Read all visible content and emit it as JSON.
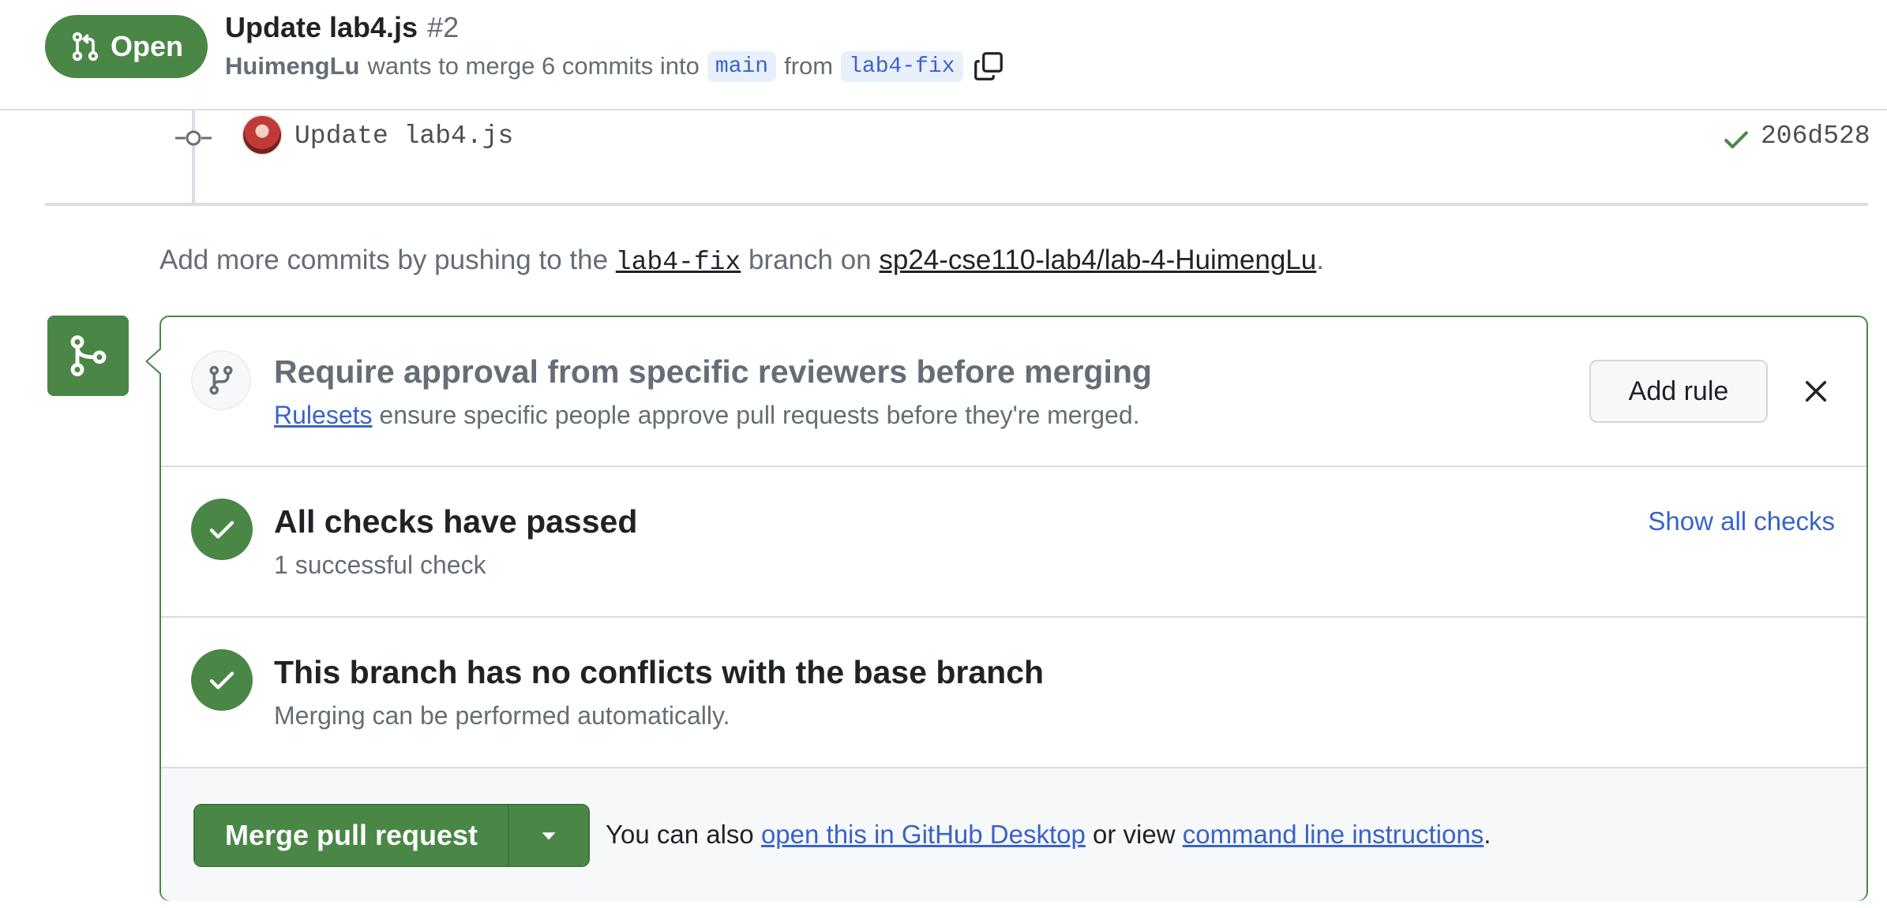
{
  "header": {
    "state_label": "Open",
    "title": "Update lab4.js",
    "number": "#2",
    "author": "HuimengLu",
    "merge_text": "wants to merge 6 commits into",
    "base_branch": "main",
    "from_text": "from",
    "head_branch": "lab4-fix"
  },
  "commit": {
    "message": "Update lab4.js",
    "sha": "206d528",
    "status": "success"
  },
  "push_hint": {
    "prefix": "Add more commits by pushing to the",
    "branch": "lab4-fix",
    "middle": "branch on",
    "repo": "sp24-cse110-lab4/lab-4-HuimengLu",
    "suffix": "."
  },
  "rules": {
    "title": "Require approval from specific reviewers before merging",
    "link_text": "Rulesets",
    "desc_rest": "ensure specific people approve pull requests before they're merged.",
    "add_rule_label": "Add rule"
  },
  "checks": {
    "title": "All checks have passed",
    "subtitle": "1 successful check",
    "show_all_label": "Show all checks"
  },
  "conflicts": {
    "title": "This branch has no conflicts with the base branch",
    "subtitle": "Merging can be performed automatically."
  },
  "merge": {
    "button_label": "Merge pull request",
    "alt_prefix": "You can also",
    "desktop_link": "open this in GitHub Desktop",
    "alt_middle": "or view",
    "cli_link": "command line instructions",
    "alt_suffix": "."
  },
  "colors": {
    "success_green": "#4a8746",
    "link_blue": "#3a63c9",
    "muted_text": "#656d76",
    "border": "#d0d7de"
  },
  "icons": {
    "state": "git-pull-request-icon",
    "copy": "copy-icon",
    "commit": "git-commit-icon",
    "check": "check-icon",
    "merge": "git-merge-icon",
    "rules": "git-branch-icon",
    "dismiss": "close-icon",
    "caret": "triangle-down-icon"
  }
}
